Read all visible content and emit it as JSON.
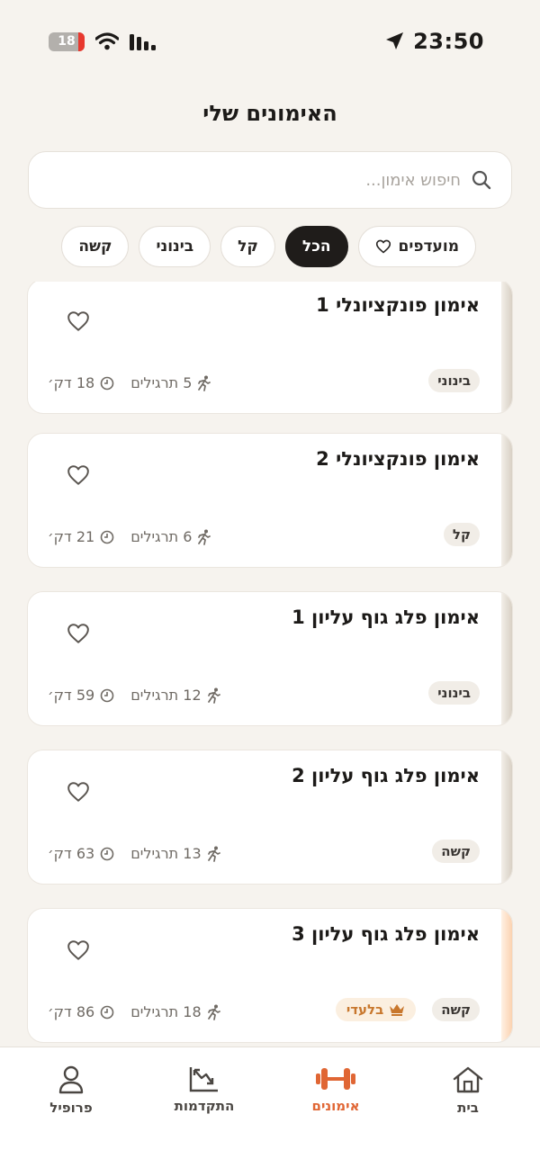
{
  "status": {
    "time": "23:50",
    "battery": "18"
  },
  "header": {
    "title": "האימונים שלי"
  },
  "search": {
    "placeholder": "חיפוש אימון..."
  },
  "filters": [
    {
      "label": "מועדפים",
      "active": false
    },
    {
      "label": "הכל",
      "active": true
    },
    {
      "label": "קל",
      "active": false
    },
    {
      "label": "בינוני",
      "active": false
    },
    {
      "label": "קשה",
      "active": false
    }
  ],
  "workouts": [
    {
      "title": "אימון פונקציונלי 1",
      "level": "בינוני",
      "duration": "18 דק׳",
      "exercises": "5 תרגילים",
      "premium": false
    },
    {
      "title": "אימון פונקציונלי 2",
      "level": "קל",
      "duration": "21 דק׳",
      "exercises": "6 תרגילים",
      "premium": false
    },
    {
      "title": "אימון פלג גוף עליון 1",
      "level": "בינוני",
      "duration": "59 דק׳",
      "exercises": "12 תרגילים",
      "premium": false
    },
    {
      "title": "אימון פלג גוף עליון 2",
      "level": "קשה",
      "duration": "63 דק׳",
      "exercises": "13 תרגילים",
      "premium": false
    },
    {
      "title": "אימון פלג גוף עליון 3",
      "level": "קשה",
      "duration": "86 דק׳",
      "exercises": "18 תרגילים",
      "premium": true,
      "premium_label": "בלעדי"
    }
  ],
  "tabs": [
    {
      "label": "בית",
      "icon": "home-icon"
    },
    {
      "label": "אימונים",
      "icon": "dumbbell-icon",
      "active": true
    },
    {
      "label": "התקדמות",
      "icon": "chart-icon"
    },
    {
      "label": "פרופיל",
      "icon": "user-icon"
    }
  ],
  "colors": {
    "accent": "#e06634",
    "active_chip": "#1f1c1a",
    "premium": "#c8772d",
    "background": "#f6f3ee"
  }
}
